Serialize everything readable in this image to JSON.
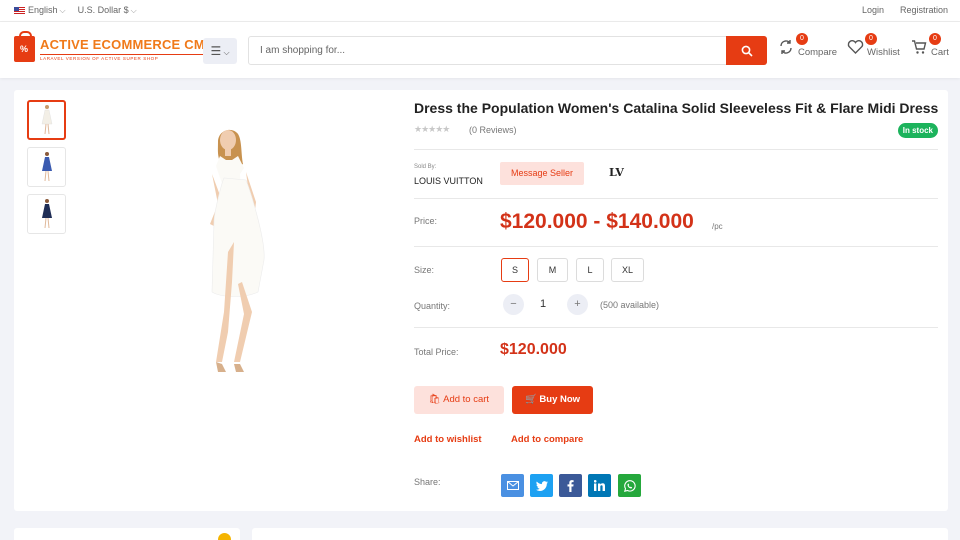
{
  "topbar": {
    "language": "English",
    "currency": "U.S. Dollar $",
    "login": "Login",
    "registration": "Registration"
  },
  "header": {
    "logo_title": "ACTIVE ECOMMERCE CMS",
    "logo_subtitle": "LARAVEL VERSION OF ACTIVE SUPER SHOP",
    "search_placeholder": "I am shopping for...",
    "compare": {
      "label": "Compare",
      "count": "0"
    },
    "wishlist": {
      "label": "Wishlist",
      "count": "0"
    },
    "cart": {
      "label": "Cart",
      "count": "0"
    }
  },
  "product": {
    "title": "Dress the Population Women's Catalina Solid Sleeveless Fit & Flare Midi Dress",
    "stars": "★★★★★",
    "reviews": "(0 Reviews)",
    "stock": "In stock",
    "sold_by_label": "Sold By:",
    "seller": "LOUIS VUITTON",
    "message_seller": "Message Seller",
    "brand_mark": "LV",
    "price_label": "Price:",
    "price": "$120.000 - $140.000",
    "unit": "/pc",
    "size_label": "Size:",
    "sizes": [
      "S",
      "M",
      "L",
      "XL"
    ],
    "selected_size": "S",
    "quantity_label": "Quantity:",
    "minus": "−",
    "quantity": "1",
    "plus": "+",
    "available": "(500 available)",
    "total_label": "Total Price:",
    "total": "$120.000",
    "add_to_cart": "Add to cart",
    "buy_now": "Buy Now",
    "add_to_wishlist": "Add to wishlist",
    "add_to_compare": "Add to compare",
    "share_label": "Share:",
    "share": [
      {
        "name": "email",
        "color": "#4a90e2"
      },
      {
        "name": "twitter",
        "color": "#1da1f2"
      },
      {
        "name": "facebook",
        "color": "#3b5998"
      },
      {
        "name": "linkedin",
        "color": "#0077b5"
      },
      {
        "name": "whatsapp",
        "color": "#25a83c"
      }
    ]
  },
  "colors": {
    "accent": "#e63c13",
    "price": "#d33218",
    "stock": "#1cb35c"
  }
}
